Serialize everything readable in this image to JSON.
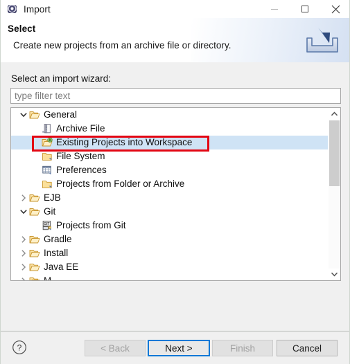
{
  "window": {
    "title": "Import",
    "icon": "eclipse-import-icon",
    "controls": {
      "minimize": "minimize-icon",
      "maximize": "maximize-icon",
      "close": "close-icon"
    }
  },
  "header": {
    "title": "Select",
    "description": "Create new projects from an archive file or directory.",
    "icon": "import-arrow-into-tray-icon"
  },
  "body": {
    "wizard_label": "Select an import wizard:",
    "filter": {
      "value": "",
      "placeholder": "type filter text"
    }
  },
  "tree": {
    "items": [
      {
        "label": "General",
        "level": 0,
        "twisty": "expanded",
        "icon": "open-folder-icon",
        "selected": false
      },
      {
        "label": "Archive File",
        "level": 1,
        "twisty": "none",
        "icon": "archive-file-icon",
        "selected": false
      },
      {
        "label": "Existing Projects into Workspace",
        "level": 1,
        "twisty": "none",
        "icon": "import-projects-icon",
        "selected": true
      },
      {
        "label": "File System",
        "level": 1,
        "twisty": "none",
        "icon": "folder-icon",
        "selected": false
      },
      {
        "label": "Preferences",
        "level": 1,
        "twisty": "none",
        "icon": "preferences-icon",
        "selected": false
      },
      {
        "label": "Projects from Folder or Archive",
        "level": 1,
        "twisty": "none",
        "icon": "folder-icon",
        "selected": false
      },
      {
        "label": "EJB",
        "level": 0,
        "twisty": "collapsed",
        "icon": "open-folder-icon",
        "selected": false
      },
      {
        "label": "Git",
        "level": 0,
        "twisty": "expanded",
        "icon": "open-folder-icon",
        "selected": false
      },
      {
        "label": "Projects from Git",
        "level": 1,
        "twisty": "none",
        "icon": "git-icon",
        "selected": false
      },
      {
        "label": "Gradle",
        "level": 0,
        "twisty": "collapsed",
        "icon": "open-folder-icon",
        "selected": false
      },
      {
        "label": "Install",
        "level": 0,
        "twisty": "collapsed",
        "icon": "open-folder-icon",
        "selected": false
      },
      {
        "label": "Java EE",
        "level": 0,
        "twisty": "collapsed",
        "icon": "open-folder-icon",
        "selected": false
      },
      {
        "label": "M",
        "level": 0,
        "twisty": "collapsed",
        "icon": "open-folder-icon",
        "selected": false
      }
    ],
    "annotation": {
      "kind": "red-rectangle",
      "target": "Existing Projects into Workspace",
      "color": "#e30613"
    },
    "scrollbar": {
      "up_arrow": "scroll-up-icon",
      "down_arrow": "scroll-down-icon"
    }
  },
  "footer": {
    "help": "?",
    "buttons": [
      {
        "id": "back",
        "label": "< Back",
        "enabled": false,
        "focused": false
      },
      {
        "id": "next",
        "label": "Next >",
        "enabled": true,
        "focused": true
      },
      {
        "id": "finish",
        "label": "Finish",
        "enabled": false,
        "focused": false
      },
      {
        "id": "cancel",
        "label": "Cancel",
        "enabled": true,
        "focused": false
      }
    ]
  },
  "colors": {
    "selection": "#cfe3f5",
    "annotation": "#e30613",
    "focus": "#0078d7",
    "dialog_bg": "#f0f0f0"
  }
}
